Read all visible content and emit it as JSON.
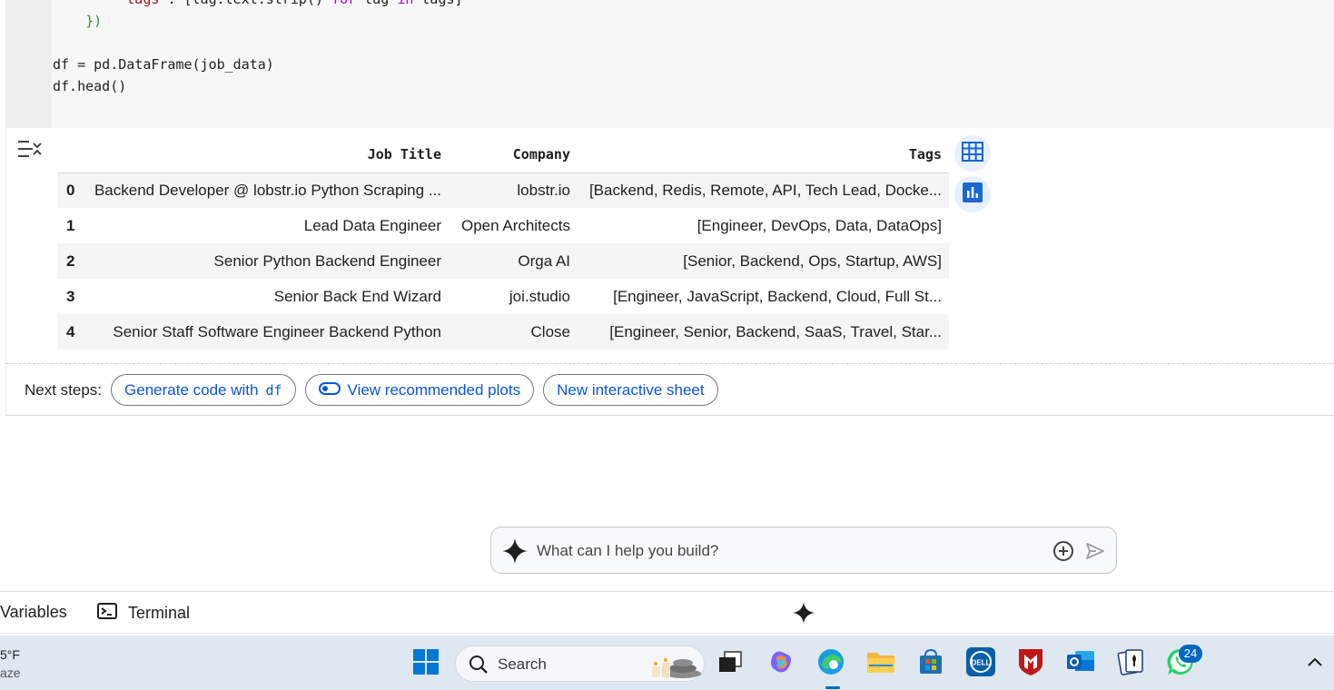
{
  "code": {
    "lines": [
      {
        "indent": "        ",
        "k1": "\"tags\"",
        "rest": ": [tag.text.strip() ",
        "kw1": "for",
        "mid": " tag ",
        "kw2": "in",
        "end": " tags]"
      },
      {
        "text": "    })"
      },
      {
        "text": ""
      },
      {
        "text": "df = pd.DataFrame(job_data)"
      },
      {
        "text": "df.head()"
      }
    ]
  },
  "table": {
    "headers": [
      "Job Title",
      "Company",
      "Tags"
    ],
    "rows": [
      {
        "index": "0",
        "title": "Backend Developer @ lobstr.io Python Scraping ...",
        "company": "lobstr.io",
        "tags": "[Backend, Redis, Remote, API, Tech Lead, Docke..."
      },
      {
        "index": "1",
        "title": "Lead Data Engineer",
        "company": "Open Architects",
        "tags": "[Engineer, DevOps, Data, DataOps]"
      },
      {
        "index": "2",
        "title": "Senior Python Backend Engineer",
        "company": "Orga AI",
        "tags": "[Senior, Backend, Ops, Startup, AWS]"
      },
      {
        "index": "3",
        "title": "Senior Back End Wizard",
        "company": "joi.studio",
        "tags": "[Engineer, JavaScript, Backend, Cloud, Full St..."
      },
      {
        "index": "4",
        "title": "Senior Staff Software Engineer Backend Python",
        "company": "Close",
        "tags": "[Engineer, Senior, Backend, SaaS, Travel, Star..."
      }
    ]
  },
  "next_steps": {
    "label": "Next steps:",
    "generate_label": "Generate code with",
    "generate_var": "df",
    "plots_label": "View recommended plots",
    "sheet_label": "New interactive sheet"
  },
  "prompt": {
    "placeholder": "What can I help you build?"
  },
  "bottom_bar": {
    "variables_label": "Variables",
    "terminal_label": "Terminal"
  },
  "taskbar": {
    "weather_temp": "5°F",
    "weather_desc": "aze",
    "search_label": "Search",
    "whatsapp_badge": "24"
  },
  "colors": {
    "accent": "#0b57d0",
    "taskbar_bg": "#dfe7f0"
  }
}
